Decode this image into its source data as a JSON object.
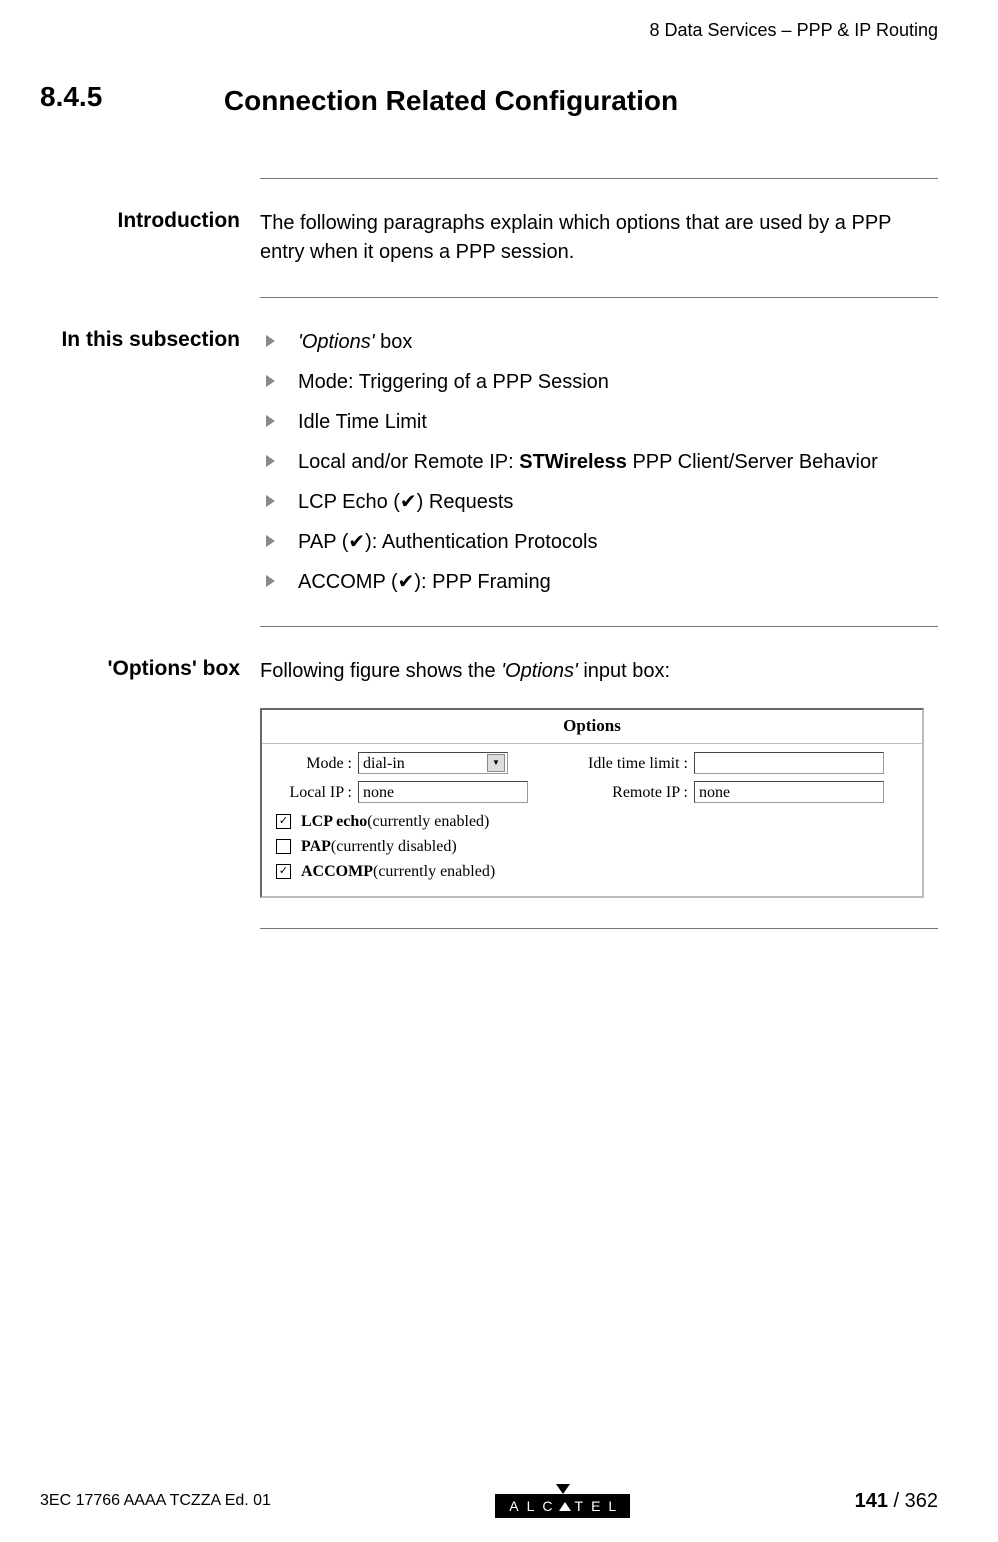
{
  "header": {
    "chapter_ref": "8   Data Services – PPP & IP Routing"
  },
  "section": {
    "number": "8.4.5",
    "title": "Connection Related Configuration"
  },
  "intro": {
    "label": "Introduction",
    "text": "The following paragraphs explain which options that are used by a PPP entry when it opens a PPP session."
  },
  "subsection": {
    "label": "In this subsection",
    "items": [
      {
        "pre_italic": "'Options'",
        "post": " box"
      },
      {
        "text": "Mode: Triggering of a PPP Session"
      },
      {
        "text": "Idle Time Limit"
      },
      {
        "pre": "Local and/or Remote IP: ",
        "bold": "STWireless",
        "post": " PPP Client/Server Behavior"
      },
      {
        "text": "LCP Echo (✔) Requests"
      },
      {
        "text": "PAP (✔): Authentication Protocols"
      },
      {
        "text": "ACCOMP (✔): PPP Framing"
      }
    ]
  },
  "options_block": {
    "label": "'Options' box",
    "intro_pre": "Following figure shows the ",
    "intro_italic": "'Options'",
    "intro_post": " input box:"
  },
  "options_box": {
    "title": "Options",
    "mode_label": "Mode :",
    "mode_value": "dial-in",
    "idle_label": "Idle time limit :",
    "idle_value": "",
    "localip_label": "Local IP :",
    "localip_value": "none",
    "remoteip_label": "Remote IP :",
    "remoteip_value": "none",
    "checks": [
      {
        "checked": true,
        "bold": "LCP echo",
        "rest": "(currently enabled)"
      },
      {
        "checked": false,
        "bold": "PAP",
        "rest": "(currently disabled)"
      },
      {
        "checked": true,
        "bold": "ACCOMP",
        "rest": "(currently enabled)"
      }
    ]
  },
  "footer": {
    "doc_id": "3EC 17766 AAAA TCZZA Ed. 01",
    "logo_pre": "ALC",
    "logo_post": "TEL",
    "page_current": "141",
    "page_total": "362"
  }
}
